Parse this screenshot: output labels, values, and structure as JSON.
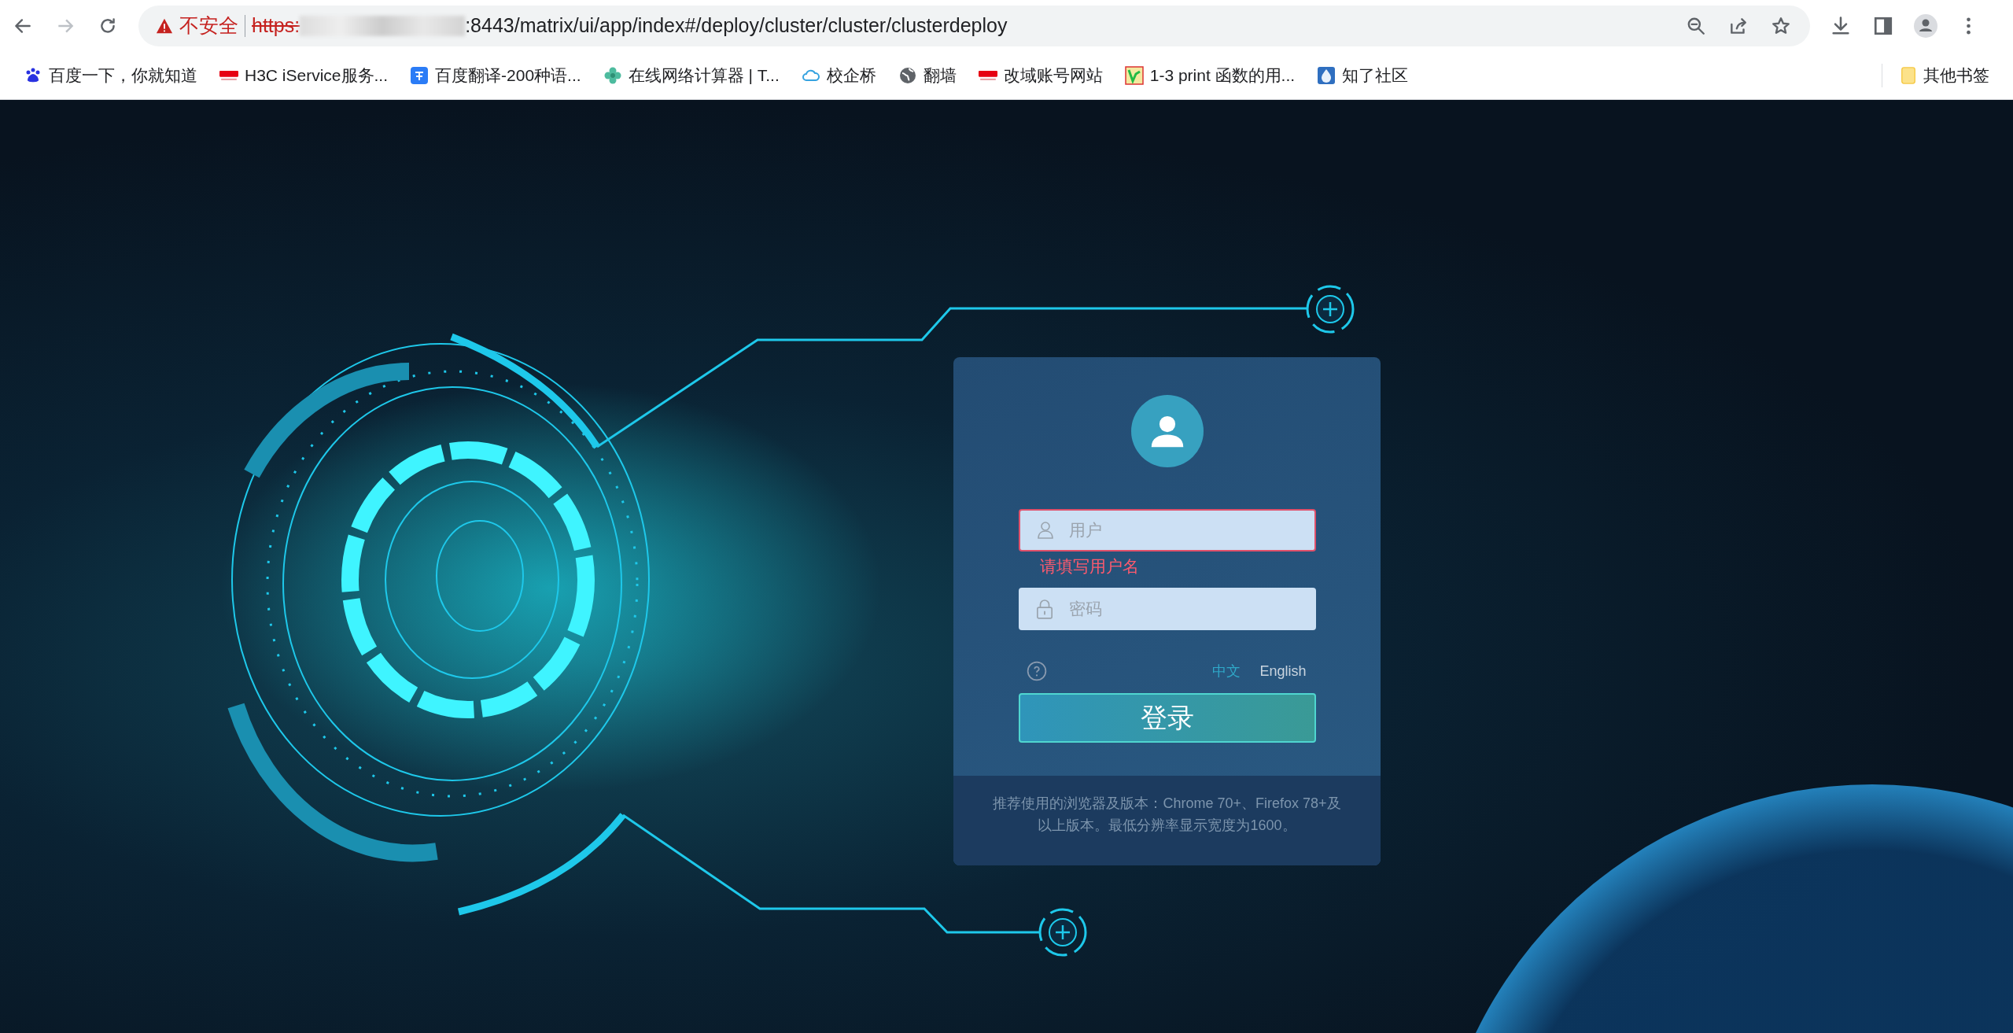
{
  "browser": {
    "address": {
      "warning": "不安全",
      "scheme": "https:",
      "rest": ":8443/matrix/ui/app/index#/deploy/cluster/cluster/clusterdeploy"
    },
    "bookmarks": [
      {
        "label": "百度一下，你就知道",
        "kind": "paw"
      },
      {
        "label": "H3C iService服务...",
        "kind": "brand"
      },
      {
        "label": "百度翻译-200种语...",
        "kind": "square"
      },
      {
        "label": "在线网络计算器 | T...",
        "kind": "flower"
      },
      {
        "label": "校企桥",
        "kind": "cloud"
      },
      {
        "label": "翻墙",
        "kind": "globe"
      },
      {
        "label": "改域账号网站",
        "kind": "brand"
      },
      {
        "label": "1-3 print 函数的用...",
        "kind": "thumb"
      },
      {
        "label": "知了社区",
        "kind": "drop"
      }
    ],
    "other_bookmarks": "其他书签"
  },
  "login": {
    "username": {
      "placeholder": "用户",
      "invalid": true
    },
    "error": "请填写用户名",
    "password": {
      "placeholder": "密码"
    },
    "languages": [
      {
        "label": "中文",
        "selected": true
      },
      {
        "label": "English",
        "selected": false
      }
    ],
    "submit": "登录",
    "note": "推荐使用的浏览器及版本：Chrome 70+、Firefox 78+及以上版本。最低分辨率显示宽度为1600。"
  }
}
